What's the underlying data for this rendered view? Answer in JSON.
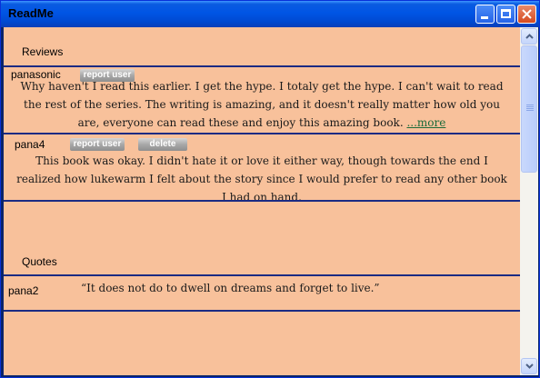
{
  "window": {
    "title": "ReadMe",
    "minimize_icon": "minimize-icon",
    "maximize_icon": "maximize-icon",
    "close_icon": "close-icon"
  },
  "reviews": {
    "heading": "Reviews",
    "items": [
      {
        "user": "panasonic",
        "report_label": "report user",
        "text": "Why haven't I read this earlier. I get the hype. I totaly get the hype. I can't wait to read the rest of the series. The writing is amazing, and it doesn't really matter how old you are, everyone can read these and enjoy this amazing book.",
        "more_label": "...more"
      },
      {
        "user": "pana4",
        "report_label": "report user",
        "delete_label": "delete",
        "text": "This book was okay. I didn't hate it or love it either way, though towards the end I realized how lukewarm I felt about the story since I would prefer to read any other book I had on hand."
      }
    ]
  },
  "quotes": {
    "heading": "Quotes",
    "items": [
      {
        "user": "pana2",
        "text": "“It does not do to dwell on dreams and forget to live.”"
      }
    ]
  },
  "colors": {
    "background": "#f8c19b",
    "divider": "#1b2b83",
    "link": "#1c6b3a",
    "titlebar": "#0055e5"
  }
}
